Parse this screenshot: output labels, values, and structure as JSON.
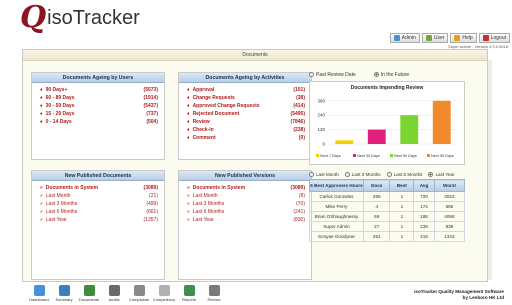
{
  "header": {
    "logo_q": "Q",
    "logo_text": "isoTracker",
    "buttons": [
      {
        "label": "Admin",
        "color": "#4a90d9"
      },
      {
        "label": "User",
        "color": "#7aa340"
      },
      {
        "label": "Help",
        "color": "#e0a020"
      },
      {
        "label": "Logout",
        "color": "#c03030"
      }
    ],
    "user_line": "Super Admin - Version 4.3.0.5018"
  },
  "main": {
    "title": "Documents"
  },
  "aging_users": {
    "title": "Documents Ageing by Users",
    "rows": [
      {
        "label": "90 Days+",
        "count": "(5573)"
      },
      {
        "label": "60 - 89 Days",
        "count": "(1914)"
      },
      {
        "label": "30 - 59 Days",
        "count": "(5437)"
      },
      {
        "label": "15 - 29 Days",
        "count": "(737)"
      },
      {
        "label": "0 - 14 Days",
        "count": "(504)"
      }
    ]
  },
  "aging_activities": {
    "title": "Documents Ageing by Activities",
    "rows": [
      {
        "label": "Approval",
        "count": "(101)"
      },
      {
        "label": "Change Requests",
        "count": "(38)"
      },
      {
        "label": "Approved Change Requests",
        "count": "(414)"
      },
      {
        "label": "Rejected Document",
        "count": "(5495)"
      },
      {
        "label": "Review",
        "count": "(7846)"
      },
      {
        "label": "Check-in",
        "count": "(238)"
      },
      {
        "label": "Comment",
        "count": "(0)"
      }
    ]
  },
  "published_docs": {
    "title": "New Published Documents",
    "rows": [
      {
        "label": "Documents in System",
        "count": "(3089)",
        "bold": true
      },
      {
        "label": "Last Month",
        "count": "(21)",
        "bold": false
      },
      {
        "label": "Last 3 Months",
        "count": "(499)",
        "bold": false
      },
      {
        "label": "Last 6 Months",
        "count": "(661)",
        "bold": false
      },
      {
        "label": "Last Year",
        "count": "(1357)",
        "bold": false
      }
    ]
  },
  "published_versions": {
    "title": "New Published Versions",
    "rows": [
      {
        "label": "Documents in System",
        "count": "(3089)",
        "bold": true
      },
      {
        "label": "Last Month",
        "count": "(8)",
        "bold": false
      },
      {
        "label": "Last 3 Months",
        "count": "(70)",
        "bold": false
      },
      {
        "label": "Last 6 Months",
        "count": "(241)",
        "bold": false
      },
      {
        "label": "Last Year",
        "count": "(830)",
        "bold": false
      }
    ]
  },
  "review_chart": {
    "radio_past": "Past Review Date",
    "radio_future": "In the Future"
  },
  "chart_data": {
    "type": "bar",
    "title": "Documents Impending Review",
    "categories": [
      "Next 7 Days",
      "Next 30 Days",
      "Next 90 Days",
      "Next 90 Days"
    ],
    "values": [
      30,
      120,
      240,
      360
    ],
    "colors": [
      "#f5d000",
      "#e0207a",
      "#7ad431",
      "#f08a2a"
    ],
    "ylim": [
      0,
      400
    ],
    "yticks": [
      0,
      120,
      240,
      360
    ],
    "xlabel": "",
    "ylabel": ""
  },
  "approvers": {
    "radios": [
      {
        "label": "Last Month",
        "on": false
      },
      {
        "label": "Last 3 Months",
        "on": false
      },
      {
        "label": "Last 6 Months",
        "on": false
      },
      {
        "label": "Last Year",
        "on": true
      }
    ],
    "headers": [
      "5 Best Approvers Hours",
      "Docs",
      "Best",
      "Avg",
      "Worst"
    ],
    "rows": [
      [
        "Carlos Gonzales",
        "266",
        "1",
        "720",
        "3023"
      ],
      [
        "Mike Perry",
        "4",
        "1",
        "174",
        "686"
      ],
      [
        "Brian OShaughnessy",
        "69",
        "1",
        "188",
        "4068"
      ],
      [
        "Super Admin",
        "27",
        "1",
        "239",
        "839"
      ],
      [
        "Sonyae Goodyear",
        "261",
        "1",
        "416",
        "1343"
      ]
    ]
  },
  "nav": [
    {
      "label": "Dashboard",
      "color": "#4a90d9"
    },
    {
      "label": "Summary",
      "color": "#3a7fc2"
    },
    {
      "label": "Documents",
      "color": "#3c8c3c"
    },
    {
      "label": "Audits",
      "color": "#6a6a6a"
    },
    {
      "label": "Complaints",
      "color": "#8a8a8a"
    },
    {
      "label": "Competency",
      "color": "#b0b0b0"
    },
    {
      "label": "Reports",
      "color": "#3f8f4f"
    },
    {
      "label": "Review",
      "color": "#7a7a7a"
    }
  ],
  "footer": {
    "line1": "isoTracker Quality Management Software",
    "line2": "by Lenboro HK Ltd"
  }
}
